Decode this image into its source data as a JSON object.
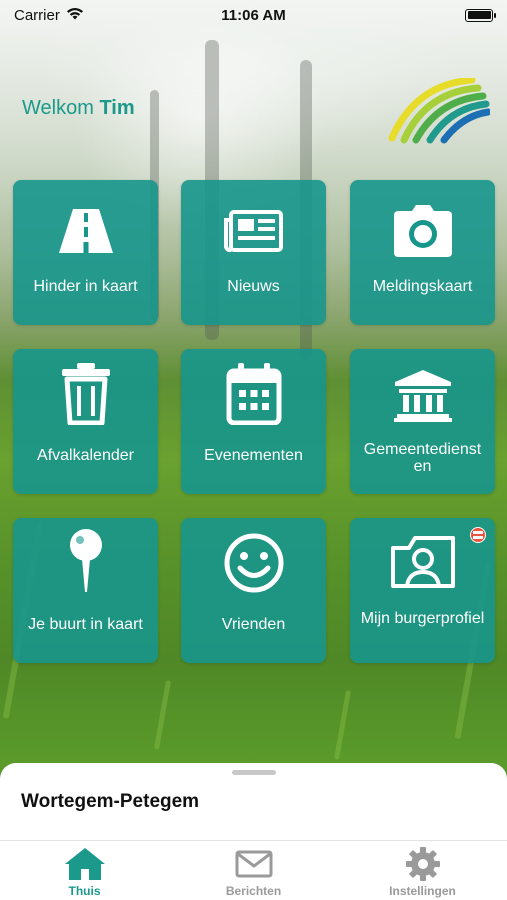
{
  "status_bar": {
    "carrier": "Carrier",
    "time": "11:06 AM",
    "wifi_icon": "wifi-icon",
    "battery_icon": "battery-icon"
  },
  "header": {
    "welcome_prefix": "Welkom",
    "user_name": "Tim",
    "logo_icon": "municipality-logo"
  },
  "tiles": [
    {
      "label": "Hinder in kaart",
      "icon": "road-icon"
    },
    {
      "label": "Nieuws",
      "icon": "newspaper-icon"
    },
    {
      "label": "Meldingskaart",
      "icon": "camera-icon"
    },
    {
      "label": "Afvalkalender",
      "icon": "trash-icon"
    },
    {
      "label": "Evenementen",
      "icon": "calendar-icon"
    },
    {
      "label": "Gemeentedienst en",
      "icon": "town-hall-icon"
    },
    {
      "label": "Je buurt in kaart",
      "icon": "map-pin-icon"
    },
    {
      "label": "Vrienden",
      "icon": "smiley-icon"
    },
    {
      "label": "Mijn burgerprofiel",
      "icon": "profile-card-icon",
      "badge": "new-badge"
    }
  ],
  "sheet": {
    "municipality": "Wortegem-Petegem"
  },
  "tabbar": {
    "tabs": [
      {
        "label": "Thuis",
        "icon": "home-icon",
        "active": true
      },
      {
        "label": "Berichten",
        "icon": "envelope-icon",
        "active": false
      },
      {
        "label": "Instellingen",
        "icon": "gear-icon",
        "active": false
      }
    ]
  },
  "colors": {
    "accent": "#1b9a8c",
    "tile": "#17968c",
    "inactive_tab": "#9a9a9a"
  }
}
